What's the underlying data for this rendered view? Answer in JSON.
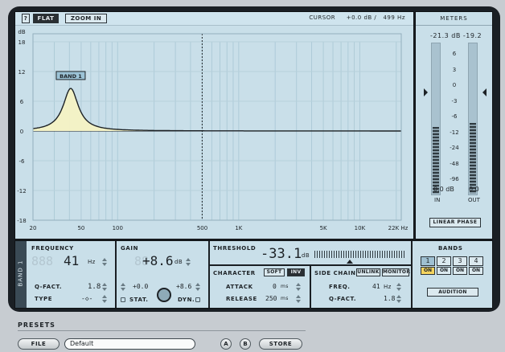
{
  "header": {
    "help_label": "?",
    "flat_label": "FLAT",
    "zoom_label": "ZOOM IN",
    "cursor_label": "CURSOR",
    "cursor_value": "+0.0 dB /",
    "cursor_freq": "499 Hz"
  },
  "graph": {
    "db_unit": "dB",
    "db_ticks": [
      "18",
      "12",
      "6",
      "0",
      "-6",
      "-12",
      "-18"
    ],
    "freq_ticks": [
      "20",
      "50",
      "100",
      "500",
      "1K",
      "5K",
      "10K",
      "22K Hz"
    ],
    "band_marker_label": "BAND 1",
    "band_freq_hz": 41,
    "band_gain_db": 8.6,
    "cursor_freq_hz": 499
  },
  "meters": {
    "title": "METERS",
    "left_readout": "-21.3",
    "readout_unit": "dB",
    "right_readout": "-19.2",
    "scale": [
      "6",
      "3",
      "0",
      "-3",
      "-6",
      "-12",
      "-24",
      "-48",
      "-96"
    ],
    "left_level": -23,
    "right_level": -21,
    "in_value": "0.0",
    "in_unit": "dB",
    "out_value": "0.0",
    "in_label": "IN",
    "out_label": "OUT",
    "linear_phase_label": "LINEAR PHASE"
  },
  "band_tab": "BAND 1",
  "frequency": {
    "title": "FREQUENCY",
    "ghost_digits": "888",
    "value": "41",
    "unit": "Hz",
    "q_label": "Q-FACT.",
    "q_value": "1.8",
    "type_label": "TYPE",
    "type_value": "-◇-"
  },
  "gain": {
    "title": "GAIN",
    "ghost_digits": "88",
    "value": "+8.6",
    "unit": "dB",
    "stat_value": "+0.0",
    "dyn_value": "+8.6",
    "stat_label": "STAT.",
    "dyn_label": "DYN."
  },
  "threshold": {
    "title": "THRESHOLD",
    "value": "-33.1",
    "unit": "dB"
  },
  "character": {
    "title": "CHARACTER",
    "soft_label": "SOFT",
    "inv_label": "INV",
    "attack_label": "ATTACK",
    "attack_value": "0",
    "attack_unit": "ms",
    "release_label": "RELEASE",
    "release_value": "250",
    "release_unit": "ms"
  },
  "side_chain": {
    "title": "SIDE CHAIN",
    "unlink_label": "UNLINK",
    "monitor_label": "MONITOR",
    "freq_label": "FREQ.",
    "freq_value": "41",
    "freq_unit": "Hz",
    "q_label": "Q-FACT.",
    "q_value": "1.8"
  },
  "bands": {
    "title": "BANDS",
    "numbers": [
      "1",
      "2",
      "3",
      "4"
    ],
    "on_label": "ON",
    "audition_label": "AUDITION"
  },
  "presets": {
    "title": "PRESETS",
    "file_label": "FILE",
    "preset_name": "Default",
    "a_label": "A",
    "b_label": "B",
    "store_label": "STORE"
  }
}
